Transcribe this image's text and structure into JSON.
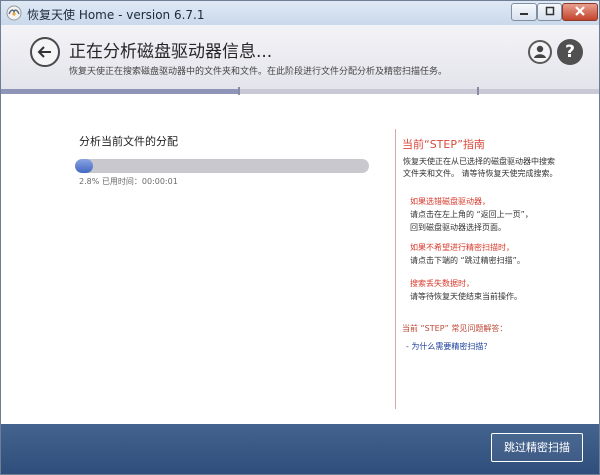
{
  "window": {
    "title": "恢复天使 Home - version 6.7.1",
    "titlebar_color": "#d3e0f0"
  },
  "header": {
    "title": "正在分析磁盘驱动器信息...",
    "subtitle": "恢复天使正在搜索磁盘驱动器中的文件夹和文件。在此阶段进行文件分配分析及精密扫描任务。",
    "help_label": "?"
  },
  "analysis": {
    "title": "分析当前文件的分配",
    "progress": 0.028,
    "progress_text": "2.8%  已用时间：00:00:01",
    "accent": "#4a6cc4"
  },
  "guide": {
    "title": "当前“STEP”指南",
    "intro_1": "恢复天使正在从已选择的磁盘驱动器中搜索",
    "intro_2": "文件夹和文件。 请等待恢复天使完成搜索。",
    "tip1_title": "如果选错磁盘驱动器，",
    "tip1_body_1": "请点击在左上角的 “返回上一页”，",
    "tip1_body_2": "回到磁盘驱动器选择页面。",
    "tip2_title": "如果不希望进行精密扫描时，",
    "tip2_body_1": "请点击下端的 “跳过精密扫描”。",
    "tip3_title": "搜索丢失数据时，",
    "tip3_body_1": "请等待恢复天使结束当前操作。",
    "faq_title": "当前 “STEP” 常见问题解答：",
    "faq_link": "- 为什么需要精密扫描？",
    "accent": "#d84a3c"
  },
  "footer": {
    "skip_label": "跳过精密扫描",
    "color": "#375683"
  }
}
